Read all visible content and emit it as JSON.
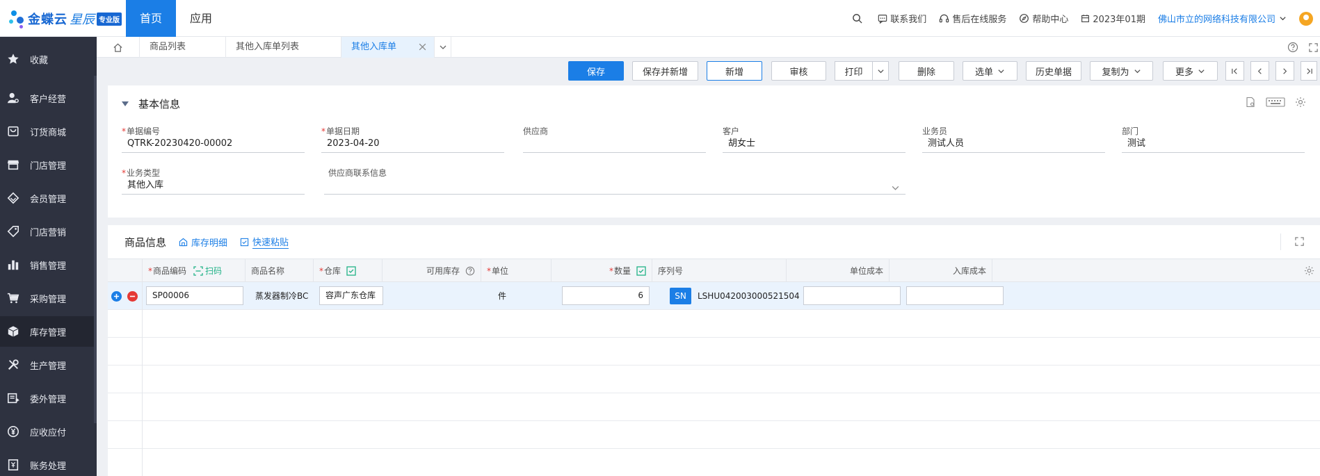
{
  "brand": {
    "name": "金蝶云",
    "sub": "星辰",
    "edition": "专业版"
  },
  "topnav": {
    "items": [
      "首页",
      "应用"
    ],
    "active_index": 0
  },
  "topright": {
    "contact": "联系我们",
    "service": "售后在线服务",
    "help": "帮助中心",
    "period": "2023年01期",
    "company": "佛山市立的网络科技有限公司"
  },
  "sidebar": {
    "items": [
      {
        "label": "收藏",
        "icon": "star-icon"
      },
      {
        "label": "客户经营",
        "icon": "user-gear-icon"
      },
      {
        "label": "订货商城",
        "icon": "shopping-bag-icon"
      },
      {
        "label": "门店管理",
        "icon": "store-icon"
      },
      {
        "label": "会员管理",
        "icon": "diamond-icon"
      },
      {
        "label": "门店营销",
        "icon": "tag-icon"
      },
      {
        "label": "销售管理",
        "icon": "bar-chart-icon"
      },
      {
        "label": "采购管理",
        "icon": "cart-icon"
      },
      {
        "label": "库存管理",
        "icon": "box-icon"
      },
      {
        "label": "生产管理",
        "icon": "tools-icon"
      },
      {
        "label": "委外管理",
        "icon": "outsource-icon"
      },
      {
        "label": "应收应付",
        "icon": "yen-coin-icon"
      },
      {
        "label": "账务处理",
        "icon": "ledger-icon"
      }
    ],
    "active_index": 8
  },
  "tabs": {
    "items": [
      "商品列表",
      "其他入库单列表",
      "其他入库单"
    ],
    "active_index": 2
  },
  "toolbar": {
    "save": "保存",
    "save_new": "保存并新增",
    "add": "新增",
    "audit": "审核",
    "print": "打印",
    "delete": "删除",
    "select": "选单",
    "history": "历史单据",
    "copy_as": "复制为",
    "more": "更多"
  },
  "basic": {
    "title": "基本信息",
    "fields": {
      "bill_no": {
        "label": "单据编号",
        "value": "QTRK-20230420-00002",
        "required": true
      },
      "bill_date": {
        "label": "单据日期",
        "value": "2023-04-20",
        "required": true
      },
      "supplier": {
        "label": "供应商",
        "value": ""
      },
      "customer": {
        "label": "客户",
        "value": "胡女士"
      },
      "salesman": {
        "label": "业务员",
        "value": "测试人员"
      },
      "department": {
        "label": "部门",
        "value": "测试"
      },
      "biz_type": {
        "label": "业务类型",
        "value": "其他入库",
        "required": true
      },
      "supplier_contact": {
        "label": "供应商联系信息",
        "value": ""
      }
    }
  },
  "goods": {
    "title": "商品信息",
    "stock_detail": "库存明细",
    "quick_paste": "快速粘贴",
    "columns": {
      "code": "商品编码",
      "scan": "扫码",
      "name": "商品名称",
      "warehouse": "仓库",
      "available": "可用库存",
      "unit": "单位",
      "qty": "数量",
      "serial": "序列号",
      "unit_cost": "单位成本",
      "in_cost": "入库成本"
    },
    "rows": [
      {
        "code": "SP00006",
        "name": "蒸发器制冷BC",
        "warehouse": "容声广东仓库",
        "unit": "件",
        "qty": "6",
        "sn_badge": "SN",
        "serial": "LSHU042003000521504",
        "unit_cost": "",
        "in_cost": ""
      }
    ]
  },
  "colors": {
    "primary": "#1b7ee6",
    "sidebar_bg": "#2e3240",
    "danger": "#e53935",
    "scan_green": "#21b287"
  }
}
